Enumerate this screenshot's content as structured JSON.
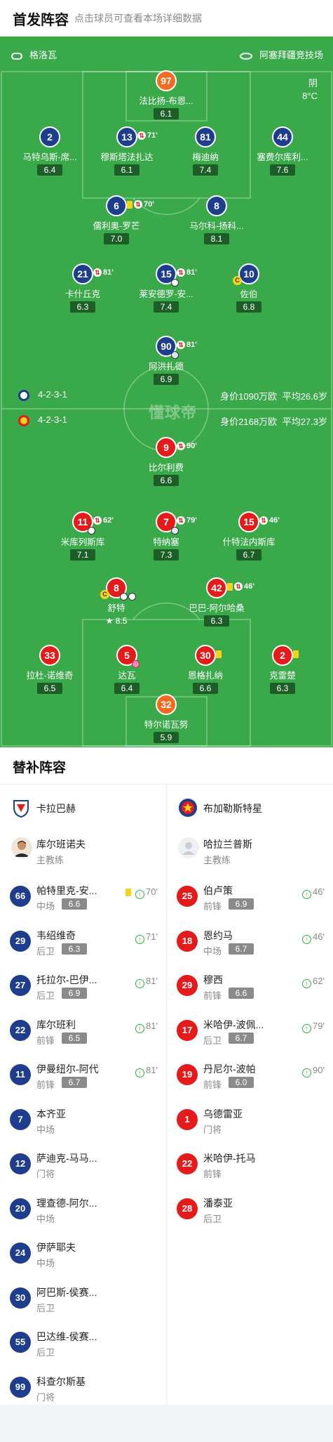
{
  "header": {
    "title": "首发阵容",
    "subtitle": "点击球员可查看本场详细数据"
  },
  "pitch": {
    "referee": "格洛瓦",
    "stadium": "阿塞拜疆竞技场",
    "weather": "阴",
    "temperature": "8°C",
    "watermark": "懂球帝",
    "home": {
      "formation": "4-2-3-1",
      "value": "身价1090万欧",
      "age": "平均26.6岁",
      "color": "#1e3d8c"
    },
    "away": {
      "formation": "4-2-3-1",
      "value": "身价2168万欧",
      "age": "平均27.3岁",
      "color": "#e51a1a"
    }
  },
  "home_players": [
    {
      "num": "97",
      "name": "法比扬-布恩...",
      "rating": "6.1",
      "color": "orange"
    },
    {
      "num": "2",
      "name": "马特乌斯-席...",
      "rating": "6.4",
      "color": "blue"
    },
    {
      "num": "13",
      "name": "穆斯塔法扎达",
      "rating": "6.1",
      "color": "blue",
      "sub": "71'"
    },
    {
      "num": "81",
      "name": "梅迪纳",
      "rating": "7.4",
      "color": "blue"
    },
    {
      "num": "44",
      "name": "塞费尔库利...",
      "rating": "7.6",
      "color": "blue"
    },
    {
      "num": "6",
      "name": "儒利奥-罗芒",
      "rating": "7.0",
      "color": "blue",
      "sub": "70'",
      "yellow": true
    },
    {
      "num": "8",
      "name": "马尔科-扬科...",
      "rating": "8.1",
      "color": "blue"
    },
    {
      "num": "21",
      "name": "卡什丘克",
      "rating": "6.3",
      "color": "blue",
      "sub": "81'"
    },
    {
      "num": "15",
      "name": "莱安德罗-安...",
      "rating": "7.4",
      "color": "blue",
      "sub": "81'",
      "goal": true
    },
    {
      "num": "10",
      "name": "佐伯",
      "rating": "6.8",
      "color": "blue",
      "captain": "C"
    },
    {
      "num": "90",
      "name": "阿洪扎德",
      "rating": "6.9",
      "color": "blue",
      "sub": "81'",
      "assist": true
    }
  ],
  "away_players": [
    {
      "num": "9",
      "name": "比尔利费",
      "rating": "6.6",
      "color": "red",
      "sub": "90'"
    },
    {
      "num": "11",
      "name": "米库列斯库",
      "rating": "7.1",
      "color": "red",
      "sub": "62'",
      "goal": true
    },
    {
      "num": "7",
      "name": "特纳塞",
      "rating": "7.3",
      "color": "red",
      "sub": "79'",
      "assist": true
    },
    {
      "num": "15",
      "name": "什特法内斯库",
      "rating": "6.7",
      "color": "red",
      "sub": "46'"
    },
    {
      "num": "8",
      "name": "舒特",
      "rating": "8.5",
      "color": "red",
      "captain": "C",
      "goals": 2,
      "star": true
    },
    {
      "num": "42",
      "name": "巴巴-阿尔哈桑",
      "rating": "6.3",
      "color": "red",
      "sub": "46'",
      "yellow": true
    },
    {
      "num": "33",
      "name": "拉杜-诺维奇",
      "rating": "6.5",
      "color": "red"
    },
    {
      "num": "5",
      "name": "达瓦",
      "rating": "6.4",
      "color": "red",
      "owngoal": true
    },
    {
      "num": "30",
      "name": "恩格扎纳",
      "rating": "6.6",
      "color": "red",
      "yellow": true
    },
    {
      "num": "2",
      "name": "克雷楚",
      "rating": "6.3",
      "color": "red",
      "yellow": true
    },
    {
      "num": "32",
      "name": "特尔诺瓦努",
      "rating": "5.9",
      "color": "orange"
    }
  ],
  "subs": {
    "title": "替补阵容",
    "home": {
      "team": "卡拉巴赫",
      "coach": "库尔班诺夫",
      "coach_role": "主教练",
      "players": [
        {
          "num": "66",
          "name": "帕特里克-安...",
          "pos": "中场",
          "rating": "6.6",
          "in": "70'",
          "yellow": true
        },
        {
          "num": "29",
          "name": "韦绍维奇",
          "pos": "后卫",
          "rating": "6.3",
          "in": "71'"
        },
        {
          "num": "27",
          "name": "托拉尔-巴伊...",
          "pos": "后卫",
          "rating": "6.9",
          "in": "81'"
        },
        {
          "num": "22",
          "name": "库尔班利",
          "pos": "前锋",
          "rating": "6.5",
          "in": "81'"
        },
        {
          "num": "11",
          "name": "伊曼纽尔-阿代",
          "pos": "前锋",
          "rating": "6.7",
          "in": "81'"
        },
        {
          "num": "7",
          "name": "本齐亚",
          "pos": "中场"
        },
        {
          "num": "12",
          "name": "萨迪克-马马...",
          "pos": "门将"
        },
        {
          "num": "20",
          "name": "理查德-阿尔...",
          "pos": "中场"
        },
        {
          "num": "24",
          "name": "伊萨耶夫",
          "pos": "中场"
        },
        {
          "num": "30",
          "name": "阿巴斯-侯赛...",
          "pos": "后卫"
        },
        {
          "num": "55",
          "name": "巴达维-侯赛...",
          "pos": "后卫"
        },
        {
          "num": "99",
          "name": "科查尔斯基",
          "pos": "门将"
        }
      ]
    },
    "away": {
      "team": "布加勒斯特星",
      "coach": "哈拉兰普斯",
      "coach_role": "主教练",
      "players": [
        {
          "num": "25",
          "name": "伯卢策",
          "pos": "前锋",
          "rating": "6.9",
          "in": "46'"
        },
        {
          "num": "18",
          "name": "恩约马",
          "pos": "中场",
          "rating": "6.7",
          "in": "46'"
        },
        {
          "num": "29",
          "name": "穆西",
          "pos": "前锋",
          "rating": "6.6",
          "in": "62'"
        },
        {
          "num": "17",
          "name": "米哈伊-波佩...",
          "pos": "后卫",
          "rating": "6.7",
          "in": "79'"
        },
        {
          "num": "19",
          "name": "丹尼尔-波帕",
          "pos": "前锋",
          "rating": "6.0",
          "in": "90'"
        },
        {
          "num": "1",
          "name": "乌德雷亚",
          "pos": "门将"
        },
        {
          "num": "22",
          "name": "米哈伊-托马",
          "pos": "前锋"
        },
        {
          "num": "28",
          "name": "潘泰亚",
          "pos": "后卫"
        }
      ]
    }
  }
}
